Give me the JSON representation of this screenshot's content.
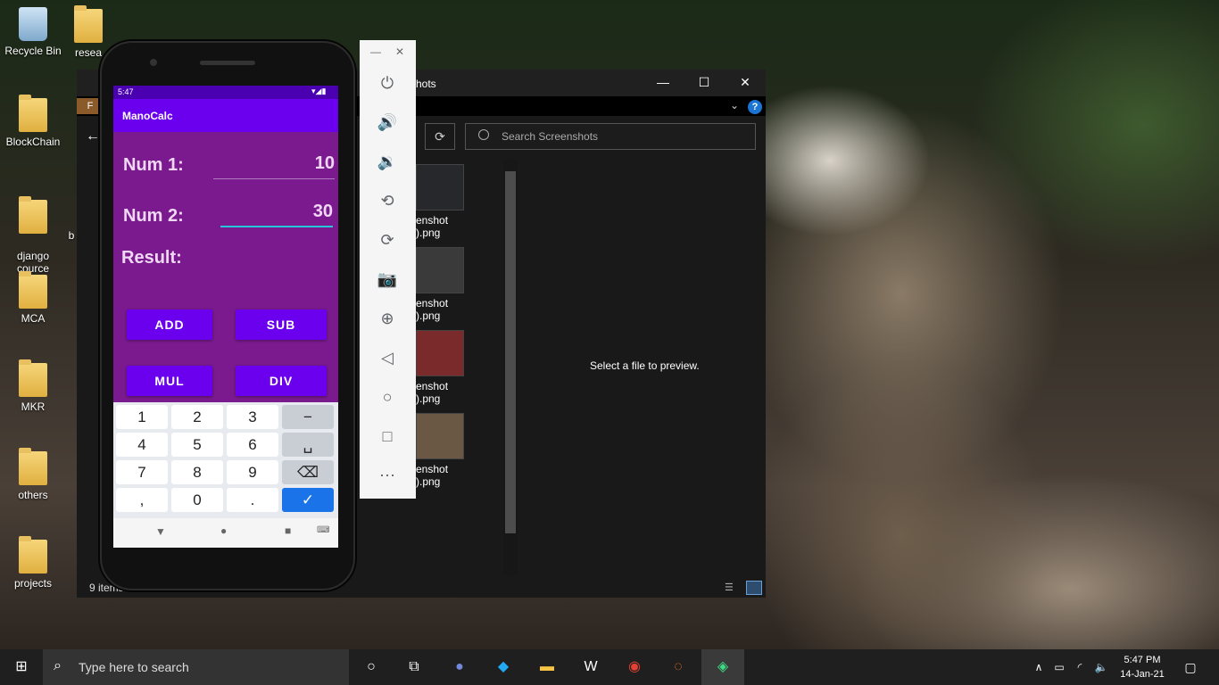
{
  "desktop": {
    "icons": [
      {
        "label": "Recycle Bin"
      },
      {
        "label": "resea"
      },
      {
        "label": "BlockChain"
      },
      {
        "label": "django\ncource"
      },
      {
        "label": "MCA"
      },
      {
        "label": "MKR"
      },
      {
        "label": "others"
      },
      {
        "label": "projects"
      }
    ],
    "partial_label": "b"
  },
  "explorer": {
    "title": "hots",
    "search_placeholder": "Search Screenshots",
    "ribbon_file": "F",
    "files": [
      {
        "line1": "enshot",
        "line2": ").png"
      },
      {
        "line1": "enshot",
        "line2": ").png"
      },
      {
        "line1": "enshot",
        "line2": ").png"
      },
      {
        "line1": "enshot",
        "line2": ").png"
      }
    ],
    "preview_text": "Select a file to preview.",
    "status": "9 items"
  },
  "phone": {
    "status_time": "5:47",
    "app_title": "ManoCalc",
    "num1_label": "Num 1:",
    "num1_value": "10",
    "num2_label": "Num 2:",
    "num2_value": "30",
    "result_label": "Result:",
    "buttons": {
      "add": "ADD",
      "sub": "SUB",
      "mul": "MUL",
      "div": "DIV"
    },
    "keys": [
      "1",
      "2",
      "3",
      "−",
      "4",
      "5",
      "6",
      "␣",
      "7",
      "8",
      "9",
      "⌫",
      ",",
      "0",
      ".",
      "✓"
    ]
  },
  "taskbar": {
    "search_placeholder": "Type here to search",
    "time": "5:47 PM",
    "date": "14-Jan-21"
  },
  "colors": {
    "app_purple": "#6a00ee",
    "screen_bg": "#7b1a8f",
    "accent_teal": "#26c6da",
    "key_blue": "#1a73e8"
  }
}
